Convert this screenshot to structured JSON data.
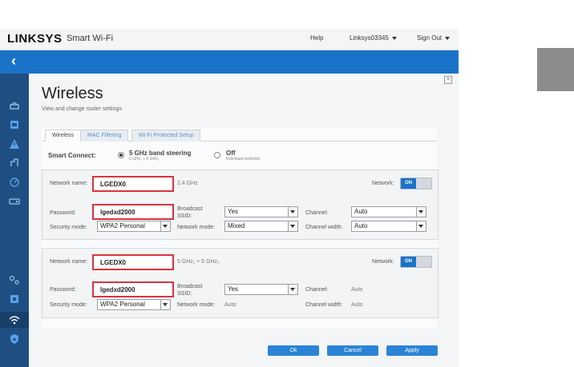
{
  "app": {
    "logo": "LINKSYS",
    "logo_sub": "Smart Wi-Fi"
  },
  "topbar": {
    "help": "Help",
    "account": "Linksys03345",
    "sign_out": "Sign Out"
  },
  "nav": {
    "back_icon": "chevron-left-icon"
  },
  "sidebar_icons": [
    "devices-icon",
    "parental-controls-icon",
    "troubleshooting-icon",
    "media-prioritization-icon",
    "speed-test-icon",
    "external-storage-icon",
    "connectivity-icon",
    "router-settings-icon",
    "wireless-icon",
    "security-icon"
  ],
  "page": {
    "title": "Wireless",
    "subtitle": "View and change router settings",
    "close": "×"
  },
  "tabs": [
    "Wireless",
    "MAC Filtering",
    "Wi-Fi Protected Setup"
  ],
  "smart_connect": {
    "label": "Smart Connect:",
    "option1_label": "5 GHz band steering",
    "option1_sub": "5 GHz₁ + 5 GHz₂",
    "option2_label": "Off",
    "option2_sub": "Individual networks"
  },
  "network1": {
    "name_label": "Network name:",
    "name_value": "LGEDX0",
    "band": "2.4 GHz",
    "network_label": "Network:",
    "toggle": "ON",
    "password_label": "Password:",
    "password_value": "lgedxd2000",
    "broadcast_label": "Broadcast SSID:",
    "broadcast_value": "Yes",
    "channel_label": "Channel:",
    "channel_value": "Auto",
    "security_label": "Security mode:",
    "security_value": "WPA2 Personal",
    "mode_label": "Network mode:",
    "mode_value": "Mixed",
    "width_label": "Channel width:",
    "width_value": "Auto"
  },
  "network2": {
    "name_label": "Network name:",
    "name_value": "LGEDX0",
    "band": "5 GHz₁ + 5 GHz₂",
    "network_label": "Network:",
    "toggle": "ON",
    "password_label": "Password:",
    "password_value": "lgedxd2000",
    "broadcast_label": "Broadcast SSID:",
    "broadcast_value": "Yes",
    "channel_label": "Channel:",
    "channel_value": "Auto",
    "security_label": "Security mode:",
    "security_value": "WPA2 Personal",
    "mode_label": "Network mode:",
    "mode_value": "Auto",
    "width_label": "Channel width:",
    "width_value": "Auto"
  },
  "buttons": {
    "ok": "Ok",
    "cancel": "Cancel",
    "apply": "Apply"
  }
}
